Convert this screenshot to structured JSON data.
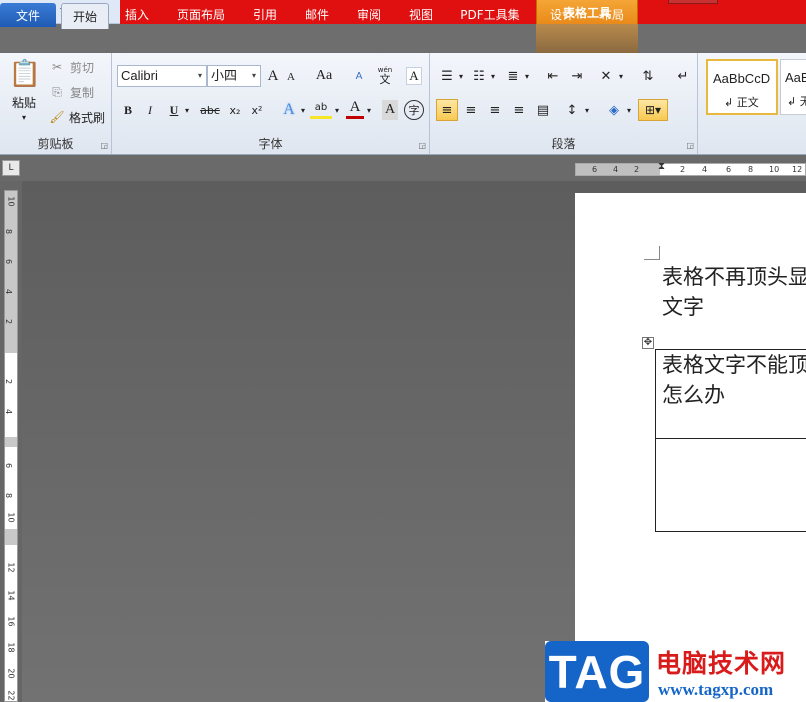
{
  "titlebar": {
    "contextual_group": "表格工具",
    "qat_icons": [
      "word-icon",
      "save-icon",
      "undo-icon",
      "redo-icon",
      "customize-icon"
    ]
  },
  "tabs": {
    "file": "文件",
    "home": "开始",
    "insert": "插入",
    "layout": "页面布局",
    "references": "引用",
    "mailings": "邮件",
    "review": "审阅",
    "view": "视图",
    "pdf": "PDF工具集",
    "design": "设计",
    "table_layout": "布局"
  },
  "clipboard": {
    "paste": "粘贴",
    "cut": "剪切",
    "copy": "复制",
    "format_painter": "格式刷",
    "label": "剪贴板"
  },
  "font": {
    "name": "Calibri",
    "size": "小四",
    "grow": "A",
    "shrink": "A",
    "change_case": "Aa",
    "clear_format": "A",
    "phonetic": "wén",
    "phonetic_char": "文",
    "border_char": "A",
    "bold": "B",
    "italic": "I",
    "underline": "U",
    "strike": "abc",
    "subscript": "x₂",
    "superscript": "x²",
    "text_effect": "A",
    "highlight": "ab",
    "font_color": "A",
    "char_shading": "A",
    "enclose": "字",
    "label": "字体"
  },
  "paragraph": {
    "label": "段落"
  },
  "styles": {
    "normal_sample": "AaBbCcD",
    "normal_name": "正文",
    "nospacing_sample": "AaB",
    "nospacing_name": "无"
  },
  "ruler": {
    "corner": "L",
    "h_labels": [
      "6",
      "4",
      "2",
      "2",
      "4",
      "6",
      "8",
      "10",
      "12"
    ],
    "v_labels": [
      "10",
      "8",
      "6",
      "4",
      "2",
      "2",
      "4",
      "6",
      "8",
      "10",
      "12",
      "14",
      "16",
      "18",
      "20",
      "22"
    ]
  },
  "document": {
    "para_line1": "表格不再顶头显",
    "para_line2": "文字",
    "table_cell_line1": "表格文字不能顶",
    "table_cell_line2": "怎么办",
    "move_handle": "✥"
  },
  "watermark": {
    "tag": "TAG",
    "site_name": "电脑技术网",
    "url": "www.tagxp.com"
  },
  "colors": {
    "title_bar": "#e01010",
    "contextual_tab": "#f0a030",
    "file_tab": "#2a6bc8",
    "selected_button": "#f8c952",
    "watermark_blue": "#1565c8",
    "watermark_red": "#d81b1b"
  }
}
